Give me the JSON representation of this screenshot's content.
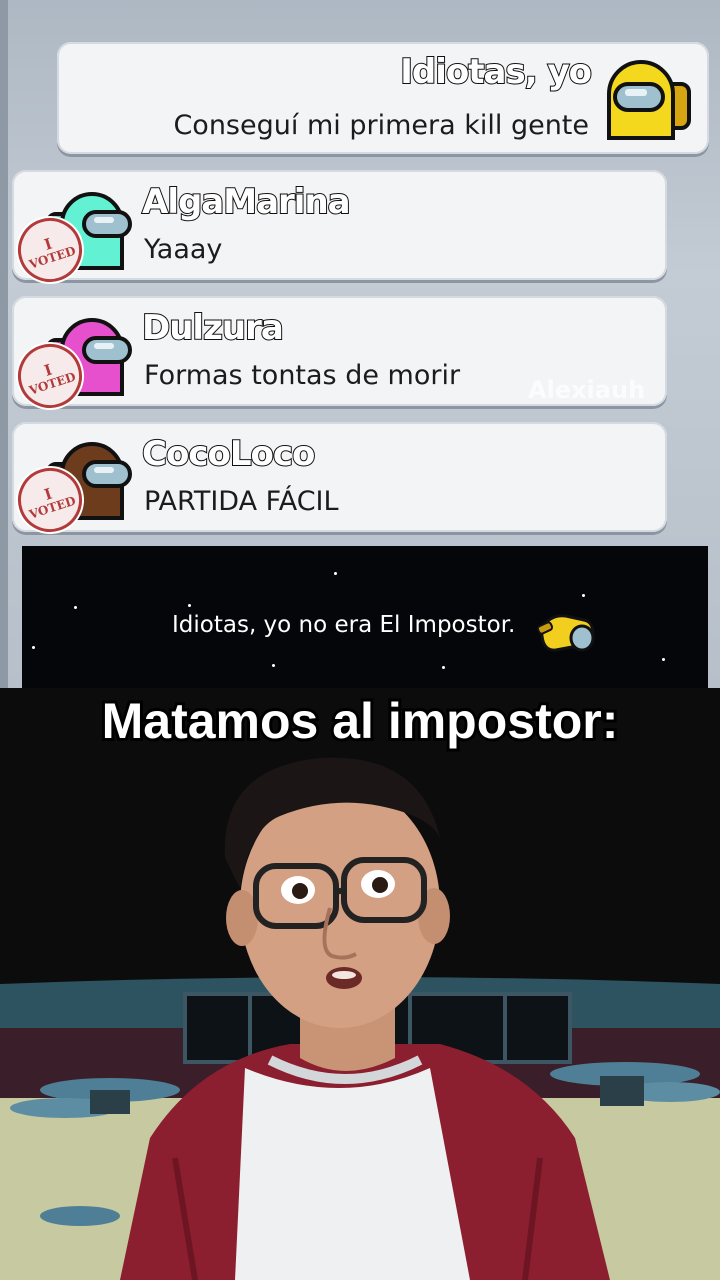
{
  "chat": {
    "own_message": {
      "name": "Idiotas, yo",
      "text": "Conseguí mi primera kill gente",
      "color": "#f0d31f"
    },
    "messages": [
      {
        "name": "AlgaMarina",
        "text": "Yaaay",
        "color": "#5ef0d0",
        "voted": true
      },
      {
        "name": "Dulzura",
        "text": "Formas tontas de morir",
        "color": "#e34fcb",
        "voted": true
      },
      {
        "name": "CocoLoco",
        "text": "PARTIDA FÁCIL",
        "color": "#6a3a1e",
        "voted": true
      }
    ],
    "voted_badge": {
      "line1": "I",
      "line2": "VOTED"
    },
    "watermark": "Alexiauh"
  },
  "ejection": {
    "text": "Idiotas, yo no era El Impostor."
  },
  "meme": {
    "caption": "Matamos al impostor:"
  }
}
